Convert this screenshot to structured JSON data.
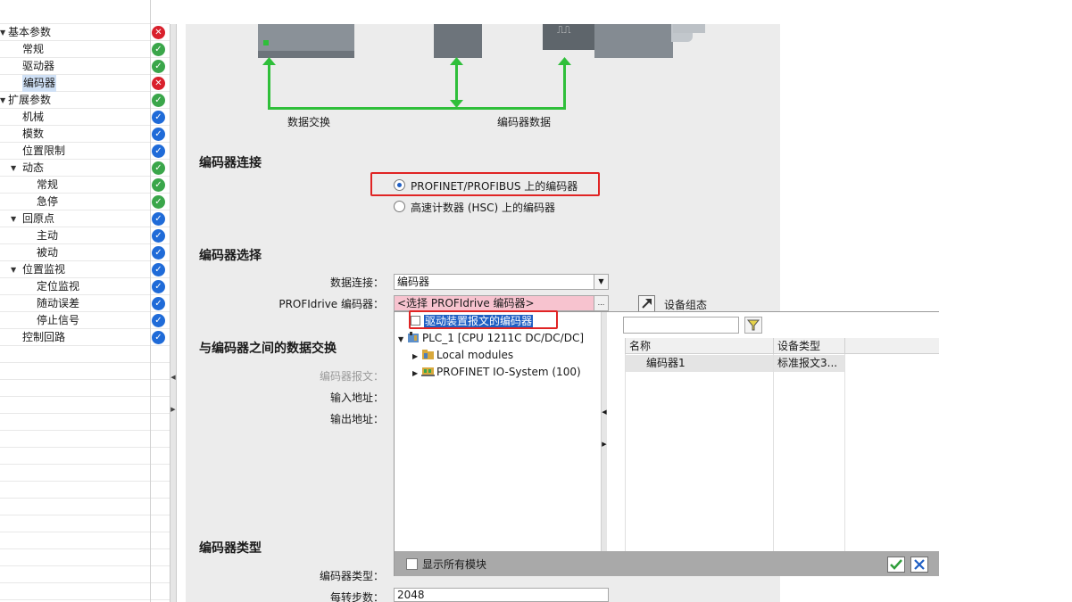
{
  "tree": {
    "items": [
      {
        "label": "基本参数",
        "status": "red",
        "level": 0,
        "arrow": true
      },
      {
        "label": "常规",
        "status": "green",
        "level": 1
      },
      {
        "label": "驱动器",
        "status": "green",
        "level": 1
      },
      {
        "label": "编码器",
        "status": "red",
        "level": 1,
        "selected": true
      },
      {
        "label": "扩展参数",
        "status": "green",
        "level": 0,
        "arrow": true
      },
      {
        "label": "机械",
        "status": "blue",
        "level": 1
      },
      {
        "label": "模数",
        "status": "blue",
        "level": 1
      },
      {
        "label": "位置限制",
        "status": "blue",
        "level": 1
      },
      {
        "label": "动态",
        "status": "green",
        "level": 1,
        "arrow": true
      },
      {
        "label": "常规",
        "status": "green",
        "level": 2
      },
      {
        "label": "急停",
        "status": "green",
        "level": 2
      },
      {
        "label": "回原点",
        "status": "blue",
        "level": 1,
        "arrow": true
      },
      {
        "label": "主动",
        "status": "blue",
        "level": 2
      },
      {
        "label": "被动",
        "status": "blue",
        "level": 2
      },
      {
        "label": "位置监视",
        "status": "blue",
        "level": 1,
        "arrow": true
      },
      {
        "label": "定位监视",
        "status": "blue",
        "level": 2
      },
      {
        "label": "随动误差",
        "status": "blue",
        "level": 2
      },
      {
        "label": "停止信号",
        "status": "blue",
        "level": 2
      },
      {
        "label": "控制回路",
        "status": "blue",
        "level": 1
      }
    ]
  },
  "diagram": {
    "label_data_exchange": "数据交换",
    "label_encoder_data": "编码器数据"
  },
  "encoder_connection": {
    "title": "编码器连接",
    "option1": "PROFINET/PROFIBUS 上的编码器",
    "option2": "高速计数器 (HSC) 上的编码器",
    "selected": 1
  },
  "encoder_selection": {
    "title": "编码器选择",
    "data_connection_label": "数据连接：",
    "data_connection_value": "编码器",
    "profidrive_label": "PROFIdrive 编码器：",
    "profidrive_value": "<选择 PROFIdrive 编码器>",
    "device_config_label": "设备组态"
  },
  "data_exchange": {
    "title": "与编码器之间的数据交换",
    "telegram_label": "编码器报文：",
    "input_address_label": "输入地址：",
    "output_address_label": "输出地址："
  },
  "encoder_type": {
    "title": "编码器类型",
    "type_label": "编码器类型：",
    "steps_label": "每转步数：",
    "steps_value": "2048"
  },
  "popup": {
    "tree": {
      "item_drive_telegram": "驱动装置报文的编码器",
      "item_plc": "PLC_1 [CPU 1211C DC/DC/DC]",
      "item_local": "Local modules",
      "item_profinet": "PROFINET IO-System (100)"
    },
    "search_placeholder": "",
    "table": {
      "headers": [
        "名称",
        "设备类型"
      ],
      "rows": [
        {
          "name": "编码器1",
          "type": "标准报文3..."
        }
      ]
    },
    "show_all_modules": "显示所有模块"
  },
  "colors": {
    "status_green": "#3aa64a",
    "status_red": "#d9202c",
    "status_blue": "#1f6bd8",
    "diagram_line": "#2fbf3a",
    "highlight_red": "#e02424",
    "invalid_field": "#f7c3cf"
  }
}
